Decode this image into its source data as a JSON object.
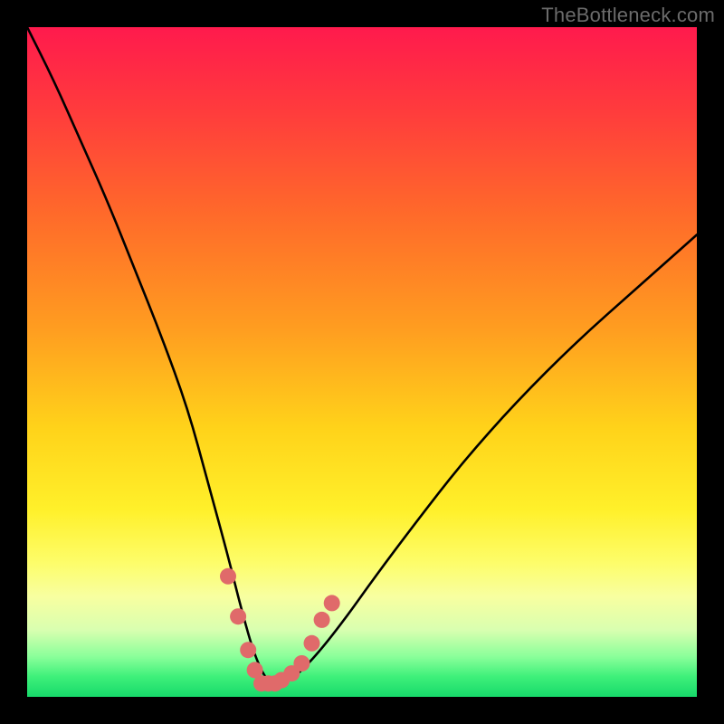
{
  "watermark": "TheBottleneck.com",
  "chart_data": {
    "type": "line",
    "title": "",
    "xlabel": "",
    "ylabel": "",
    "xlim": [
      0,
      100
    ],
    "ylim": [
      0,
      100
    ],
    "series": [
      {
        "name": "bottleneck-curve",
        "x": [
          0,
          4,
          8,
          12,
          16,
          20,
          24,
          27,
          30,
          32,
          34,
          36,
          38,
          40,
          43,
          47,
          52,
          58,
          65,
          73,
          82,
          91,
          100
        ],
        "values": [
          100,
          92,
          83,
          74,
          64,
          54,
          43,
          32,
          21,
          13,
          6,
          2,
          2,
          3,
          6,
          11,
          18,
          26,
          35,
          44,
          53,
          61,
          69
        ]
      }
    ],
    "markers": {
      "name": "highlight-points",
      "color": "#e06a6a",
      "radius": 9,
      "x": [
        30.0,
        31.5,
        33.0,
        34.0,
        35.0,
        36.0,
        37.0,
        38.0,
        39.5,
        41.0,
        42.5,
        44.0,
        45.5
      ],
      "values": [
        18.0,
        12.0,
        7.0,
        4.0,
        2.0,
        2.0,
        2.0,
        2.5,
        3.5,
        5.0,
        8.0,
        11.5,
        14.0
      ]
    },
    "gradient_stops": [
      {
        "pos": 0,
        "color": "#ff1a4d"
      },
      {
        "pos": 45,
        "color": "#ff9d20"
      },
      {
        "pos": 72,
        "color": "#fff02a"
      },
      {
        "pos": 97,
        "color": "#3ef07a"
      },
      {
        "pos": 100,
        "color": "#17d96a"
      }
    ]
  }
}
